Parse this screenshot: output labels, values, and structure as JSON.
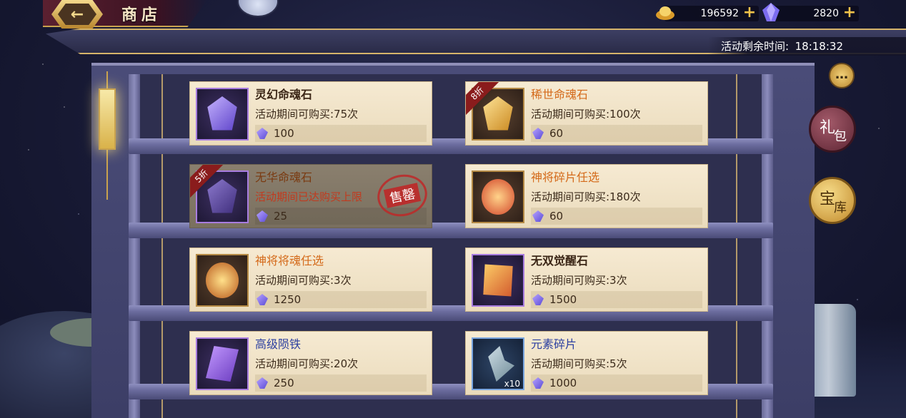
{
  "header": {
    "title": "商店",
    "back_icon": "back-arrow-icon"
  },
  "currencies": [
    {
      "icon": "gold-ingot-icon",
      "value": "196592"
    },
    {
      "icon": "crystal-icon",
      "value": "2820"
    }
  ],
  "timer": {
    "label": "活动剩余时间:",
    "value": "18:18:32"
  },
  "side": {
    "gift_c1": "礼",
    "gift_c2": "包",
    "vault_c1": "宝",
    "vault_c2": "库",
    "chat": "…"
  },
  "items": [
    {
      "name": "灵幻命魂石",
      "limit": "活动期间可购买:75次",
      "price": "100"
    },
    {
      "name": "稀世命魂石",
      "limit": "活动期间可购买:100次",
      "price": "60",
      "discount": "8折"
    },
    {
      "name": "无华命魂石",
      "limit": "活动期间已达购买上限",
      "price": "25",
      "discount": "5折",
      "soldout": "售罄"
    },
    {
      "name": "神将碎片任选",
      "limit": "活动期间可购买:180次",
      "price": "60"
    },
    {
      "name": "神将将魂任选",
      "limit": "活动期间可购买:3次",
      "price": "1250"
    },
    {
      "name": "无双觉醒石",
      "limit": "活动期间可购买:3次",
      "price": "1500"
    },
    {
      "name": "高级陨铁",
      "limit": "活动期间可购买:20次",
      "price": "250"
    },
    {
      "name": "元素碎片",
      "limit": "活动期间可购买:5次",
      "price": "1000",
      "quantity": "x10"
    }
  ],
  "colors": {
    "accent_gold": "#c9a24e",
    "name_orange": "#d46a1a",
    "soldout_red": "#be2828"
  }
}
